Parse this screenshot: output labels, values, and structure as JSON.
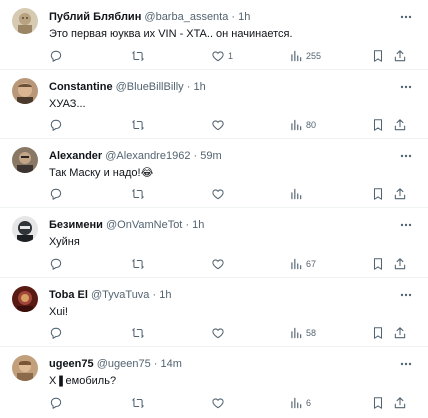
{
  "tweets": [
    {
      "name": "Публий Бляблин",
      "handle": "@barba_assenta",
      "separator": "·",
      "time": "1h",
      "text": "Это первая юуква их VIN - XTA.. он начинается.",
      "counts": {
        "reply": "",
        "retweet": "",
        "like": "1",
        "views": "255"
      },
      "avatar_color": "#c9b89a"
    },
    {
      "name": "Constantine",
      "handle": "@BlueBillBilly",
      "separator": "·",
      "time": "1h",
      "text": "ХУАЗ...",
      "counts": {
        "reply": "",
        "retweet": "",
        "like": "",
        "views": "80"
      },
      "avatar_color": "#a8866a"
    },
    {
      "name": "Alexander",
      "handle": "@Alexandre1962",
      "separator": "·",
      "time": "59m",
      "text": "Так Маску и надо!😂",
      "counts": {
        "reply": "",
        "retweet": "",
        "like": "",
        "views": ""
      },
      "avatar_color": "#7d6a5a"
    },
    {
      "name": "Безимени",
      "handle": "@OnVamNeTot",
      "separator": "·",
      "time": "1h",
      "text": "Хуйня",
      "counts": {
        "reply": "",
        "retweet": "",
        "like": "",
        "views": "67"
      },
      "avatar_color": "#2f3438"
    },
    {
      "name": "Toba El",
      "handle": "@TyvaTuva",
      "separator": "·",
      "time": "1h",
      "text": "Xui!",
      "counts": {
        "reply": "",
        "retweet": "",
        "like": "",
        "views": "58"
      },
      "avatar_color": "#7a2a22"
    },
    {
      "name": "ugeen75",
      "handle": "@ugeen75",
      "separator": "·",
      "time": "14m",
      "text": "Х❚емобиль?",
      "counts": {
        "reply": "",
        "retweet": "",
        "like": "",
        "views": "6"
      },
      "avatar_color": "#9a7452"
    }
  ],
  "icons": {
    "reply": "reply-icon",
    "retweet": "retweet-icon",
    "like": "like-icon",
    "views": "views-icon",
    "bookmark": "bookmark-icon",
    "share": "share-icon",
    "more": "more-icon"
  },
  "colors": {
    "text": "#0f1419",
    "secondary": "#536471",
    "border": "#eff3f4"
  }
}
